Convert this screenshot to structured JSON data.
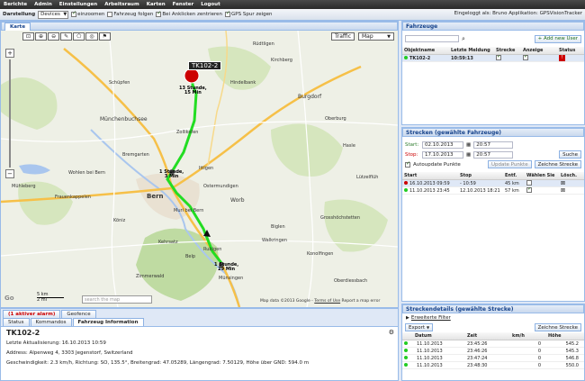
{
  "menu": [
    "Berichte",
    "Admin",
    "Einstellungen",
    "Arbeitsraum",
    "Karten",
    "Fenster",
    "Logout"
  ],
  "toolbar": {
    "darstellung_label": "Darstellung",
    "darstellung_value": "Devices",
    "einzoomen": "einzoomen",
    "fahrzeug_folgen": "Fahrzeug folgen",
    "bei_anklicken": "Bei Anklicken zentrieren",
    "gps_spur": "GPS Spur zeigen",
    "login_info": "Eingeloggt als: Bruno Applikation: GPSVisionTracker"
  },
  "map": {
    "tab": "Karte",
    "traffic_btn": "Traffic",
    "maptype": "Map",
    "vehicle_flag": "TK102-2",
    "start_label_line1": "13 Stunde,",
    "start_label_line2": "15 Min",
    "mid_label_line1": "1 Stunde,",
    "mid_label_line2": "3 Min",
    "end_label_line1": "1 Stunde,",
    "end_label_line2": "29 Min",
    "places": [
      "Zollikofen",
      "Münchenbuchsee",
      "Schüpfen",
      "Burgdorf",
      "Hindelbank",
      "Bern",
      "Worb",
      "Muri bei Bern",
      "Köniz",
      "Belp",
      "Münsingen",
      "Grosshöchstetten",
      "Konolfingen",
      "Oberdiessbach",
      "Mühleberg",
      "Frauenkappelen",
      "Wohlen bei Bern",
      "Bremgarten",
      "Ittigen",
      "Ostermundigen",
      "Oberburg",
      "Lützelflüh",
      "Hasle",
      "Kirchberg",
      "Rüdtligen",
      "Zimmerwald",
      "Kehrsatz",
      "Rubigen",
      "Biglen",
      "Walkringen"
    ],
    "scale_km": "5 km",
    "scale_mi": "2 mi",
    "search_placeholder": "search the map",
    "attribution": "Map data ©2013 Google",
    "terms": "Terms of Use",
    "report": "Report a map error"
  },
  "bottom": {
    "tabs": [
      "(1 aktiver alarm)",
      "Geofence"
    ],
    "subtabs": [
      "Status",
      "Kommandos",
      "Fahrzeug Information"
    ],
    "title": "TK102-2",
    "aktualisierung": "Letzte Aktualisierung: 16.10.2013 10:59",
    "address": "Address: Alpenweg 4, 3303 Jegenstorf, Switzerland",
    "geschw": "Geschwindigkeit: 2.3 km/h, Richtung: SO, 135.5°, Breitengrad: 47.05289, Längengrad: 7.50129, Höhe über GND: 594.0 m"
  },
  "fahrzeuge": {
    "title": "Fahrzeuge",
    "add_btn": "+ Add new User",
    "cols": [
      "Objektname",
      "Letzte Meldung",
      "Strecke",
      "Anzeige",
      "Status"
    ],
    "rows": [
      {
        "name": "TK102-2",
        "time": "10:59:13"
      }
    ]
  },
  "strecken": {
    "title": "Strecken (gewählte Fahrzeuge)",
    "start_label": "Start:",
    "start_date": "02.10.2013",
    "start_time": "20:57",
    "stop_label": "Stop:",
    "stop_date": "17.10.2013",
    "stop_time": "20:57",
    "suche": "Suche",
    "autoupdate": "Autoupdate Punkte",
    "update_btn": "Update Punkte",
    "zeichne_btn": "Zeichne Strecke",
    "cols": [
      "Start",
      "Stop",
      "Entf.",
      "Wählen Sie",
      "Lösch."
    ],
    "rows": [
      {
        "start": "16.10.2013 09:59",
        "stop": "- 10:59",
        "entf": "45 km"
      },
      {
        "start": "11.10.2013 23:45",
        "stop": "12.10.2013 18:21",
        "entf": "57 km"
      }
    ]
  },
  "details": {
    "title": "Streckendetails (gewählte Strecke)",
    "filter": "Erweiterte Filter",
    "export": "Export",
    "zeichne": "Zeichne Strecke",
    "cols": [
      "Datum",
      "Zeit",
      "km/h",
      "Höhe"
    ],
    "rows": [
      {
        "datum": "11.10.2013",
        "zeit": "23:45:26",
        "kmh": "0",
        "hoehe": "545.2"
      },
      {
        "datum": "11.10.2013",
        "zeit": "23:46:26",
        "kmh": "0",
        "hoehe": "545.3"
      },
      {
        "datum": "11.10.2013",
        "zeit": "23:47:24",
        "kmh": "0",
        "hoehe": "546.8"
      },
      {
        "datum": "11.10.2013",
        "zeit": "23:48:30",
        "kmh": "0",
        "hoehe": "550.0"
      }
    ]
  },
  "colors": {
    "route": "#22dd22",
    "marker": "#cc0000",
    "accent": "#15428b"
  }
}
